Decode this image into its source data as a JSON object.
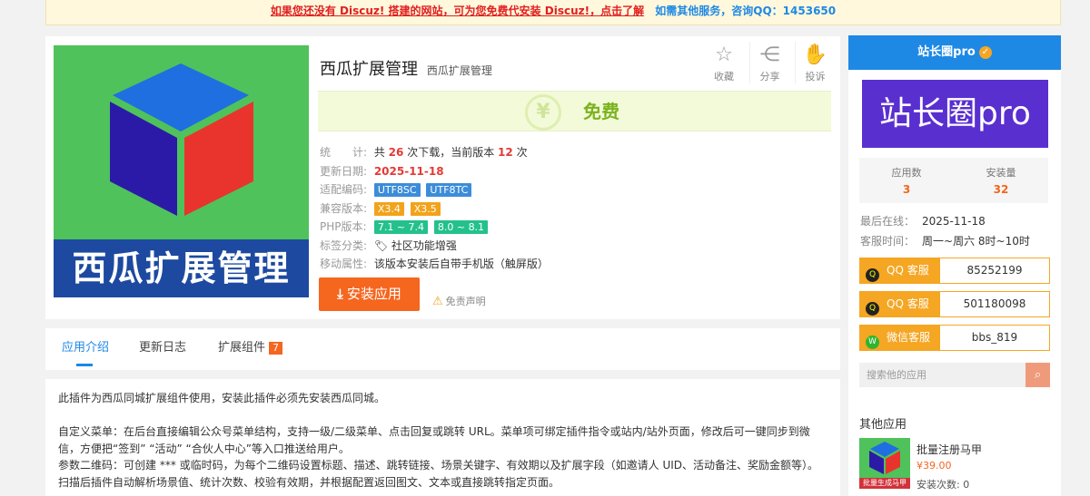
{
  "topbar": {
    "notice": "如果您还没有 Discuz! 搭建的网站，可为您免费代安装 Discuz!，点击了解",
    "service": "如需其他服务，咨询QQ：1453650"
  },
  "app": {
    "image_text": "西瓜扩展管理",
    "title": "西瓜扩展管理",
    "subtitle": "西瓜扩展管理",
    "price": "免费",
    "actions": [
      {
        "icon": "star-icon",
        "label": "收藏"
      },
      {
        "icon": "share-icon",
        "label": "分享"
      },
      {
        "icon": "hand-icon",
        "label": "投诉"
      }
    ],
    "info": {
      "stats_key": "统　　计:",
      "stats_prefix": "共",
      "downloads": "26",
      "stats_middle": "次下载，当前版本",
      "current_version_count": "12",
      "stats_suffix": "次",
      "update_key": "更新日期:",
      "update_date": "2025-11-18",
      "encoding_key": "适配编码:",
      "encodings": [
        "UTF8SC",
        "UTF8TC"
      ],
      "compat_key": "兼容版本:",
      "compat_versions": [
        "X3.4",
        "X3.5"
      ],
      "php_key": "PHP版本:",
      "php_versions": [
        "7.1 ~ 7.4",
        "8.0 ~ 8.1"
      ],
      "tags_key": "标签分类:",
      "tag": "社区功能增强",
      "mobile_key": "移动属性:",
      "mobile_value": "该版本安装后自带手机版（触屏版）"
    },
    "install_label": "安装应用",
    "disclaimer": "免责声明"
  },
  "tabs": [
    {
      "label": "应用介绍",
      "count": ""
    },
    {
      "label": "更新日志",
      "count": ""
    },
    {
      "label": "扩展组件",
      "count": "7"
    }
  ],
  "description": [
    "此插件为西瓜同城扩展组件使用，安装此插件必须先安装西瓜同城。",
    "自定义菜单：在后台直接编辑公众号菜单结构，支持一级/二级菜单、点击回复或跳转 URL。菜单项可绑定插件指令或站内/站外页面，修改后可一键同步到微信，方便把“签到” “活动” “合伙人中心”等入口推送给用户。",
    "参数二维码：可创建 *** 或临时码，为每个二维码设置标题、描述、跳转链接、场景关键字、有效期以及扩展字段（如邀请人 UID、活动备注、奖励金额等）。扫描后插件自动解析场景值、统计次数、校验有效期，并根据配置返回图文、文本或直接跳转指定页面。"
  ],
  "sidebar": {
    "header": "站长圈pro",
    "logo_text": "站长圈pro",
    "apps_label": "应用数",
    "apps_value": "3",
    "installs_label": "安装量",
    "installs_value": "32",
    "last_online_label": "最后在线：",
    "last_online_value": "2025-11-18",
    "service_time_label": "客服时间：",
    "service_time_value": "周一~周六 8时~10时",
    "services": [
      {
        "label": "QQ 客服",
        "value": "85252199"
      },
      {
        "label": "QQ 客服",
        "value": "501180098"
      },
      {
        "label": "微信客服",
        "value": "bbs_819"
      }
    ],
    "search_placeholder": "搜索他的应用",
    "other_title": "其他应用",
    "other_app": {
      "badge": "批量生成马甲",
      "name": "批量注册马甲",
      "price": "¥39.00",
      "installs": "安装次数: 0"
    }
  },
  "colors": {
    "accent_blue": "#1e88e5",
    "install_orange": "#f5661f",
    "service_orange": "#f5a623",
    "price_green": "#7ab31e"
  }
}
